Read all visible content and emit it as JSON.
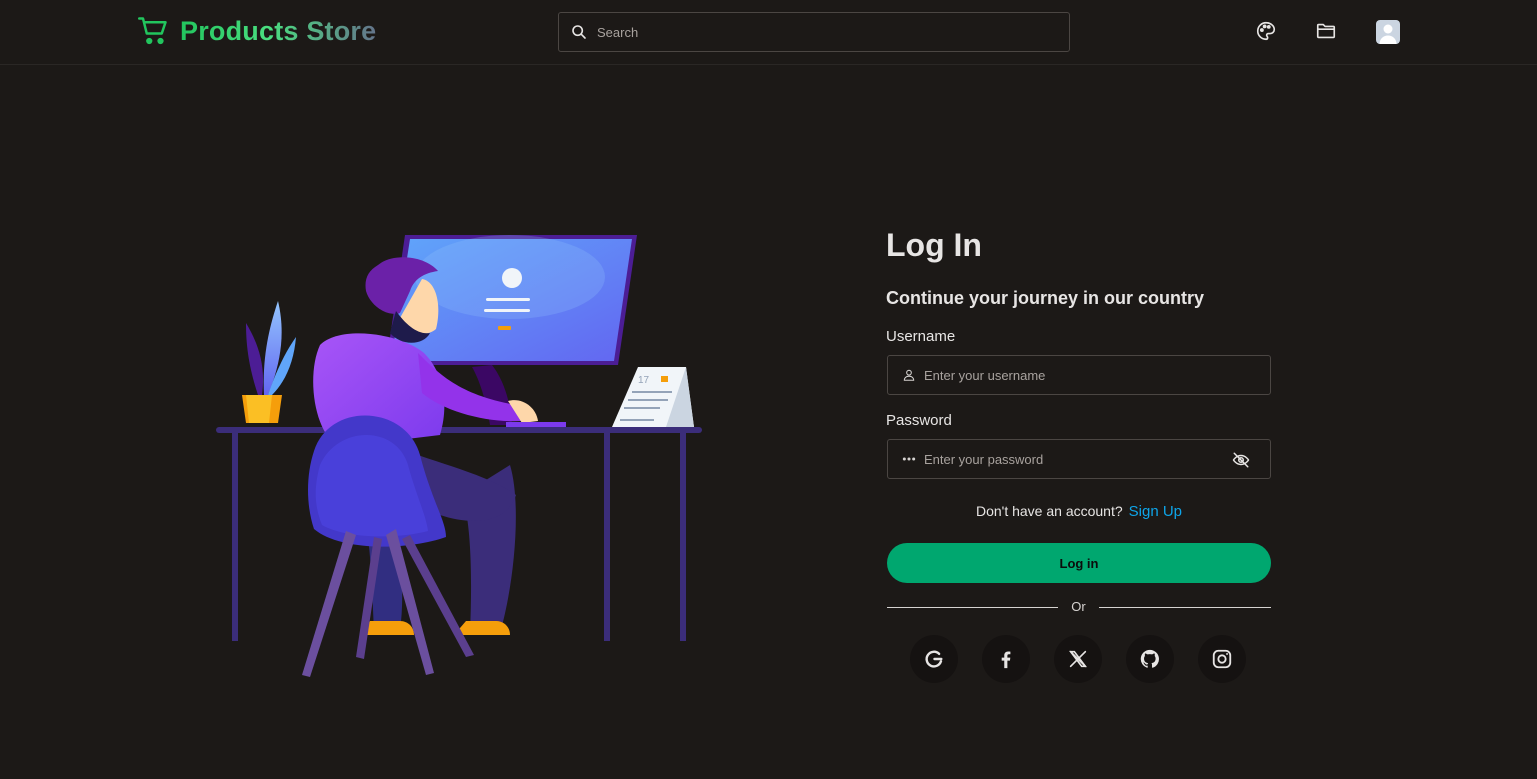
{
  "header": {
    "brand": "Products Store",
    "search_placeholder": "Search",
    "icons": [
      "cart-icon",
      "search-icon",
      "palette-icon",
      "folder-icon",
      "user-avatar"
    ]
  },
  "login": {
    "title": "Log In",
    "subtitle": "Continue your journey in our country",
    "username_label": "Username",
    "username_placeholder": "Enter your username",
    "password_label": "Password",
    "password_placeholder": "Enter your password",
    "no_account_text": "Don't have an account?",
    "signup_link": "Sign Up",
    "login_button": "Log in",
    "or_text": "Or",
    "social_icons": [
      "google-icon",
      "facebook-icon",
      "x-icon",
      "github-icon",
      "instagram-icon"
    ]
  },
  "illustration": {
    "calendar_day": "17"
  },
  "colors": {
    "background": "#1c1917",
    "brand_green": "#22c55e",
    "button_green": "#00a76f",
    "link_blue": "#0ea5e9"
  }
}
